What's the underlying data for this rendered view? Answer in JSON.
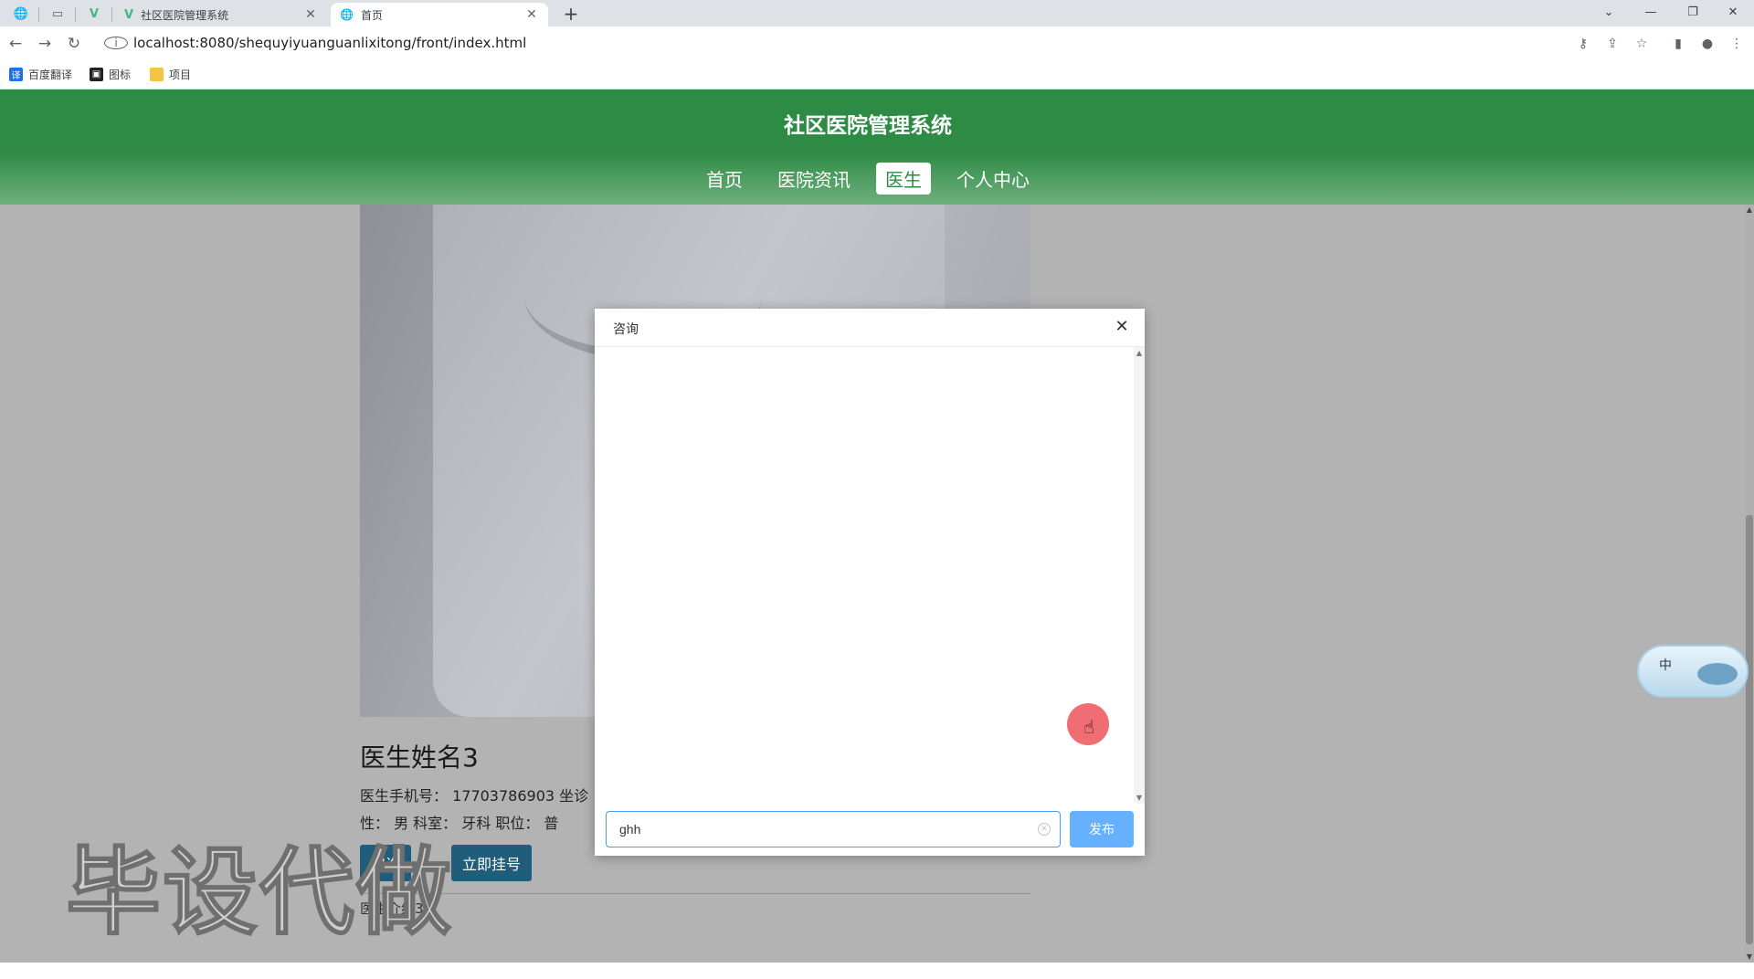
{
  "browser": {
    "tabs": [
      {
        "title": "社区医院管理系统",
        "active": false
      },
      {
        "title": "首页",
        "active": true
      }
    ],
    "new_tab_label": "+",
    "url": "localhost:8080/shequyiyuanguanlixitong/front/index.html",
    "bookmarks": [
      {
        "label": "百度翻译",
        "icon": "translate-icon",
        "color": "#1a73e8"
      },
      {
        "label": "图标",
        "icon": "image-icon",
        "color": "#222222"
      },
      {
        "label": "项目",
        "icon": "folder-icon",
        "color": "#f4c542"
      }
    ]
  },
  "site": {
    "title": "社区医院管理系统",
    "nav": [
      {
        "label": "首页",
        "active": false
      },
      {
        "label": "医院资讯",
        "active": false
      },
      {
        "label": "医生",
        "active": true
      },
      {
        "label": "个人中心",
        "active": false
      }
    ],
    "accent_color": "#2e8b45"
  },
  "doctor": {
    "name": "医生姓名3",
    "meta_line1": "医生手机号：  17703786903    坐诊",
    "meta_line2": "性：  男   科室：  牙科   职位：  普",
    "consult_button": "咨询",
    "register_button": "立即挂号",
    "intro": "医生介绍3"
  },
  "watermark": "毕设代做",
  "float_widget": {
    "label": "中"
  },
  "modal": {
    "title": "咨询",
    "close_icon": "close-icon",
    "input_value": "ghh",
    "send_button": "发布",
    "send_color": "#66b1ff"
  }
}
